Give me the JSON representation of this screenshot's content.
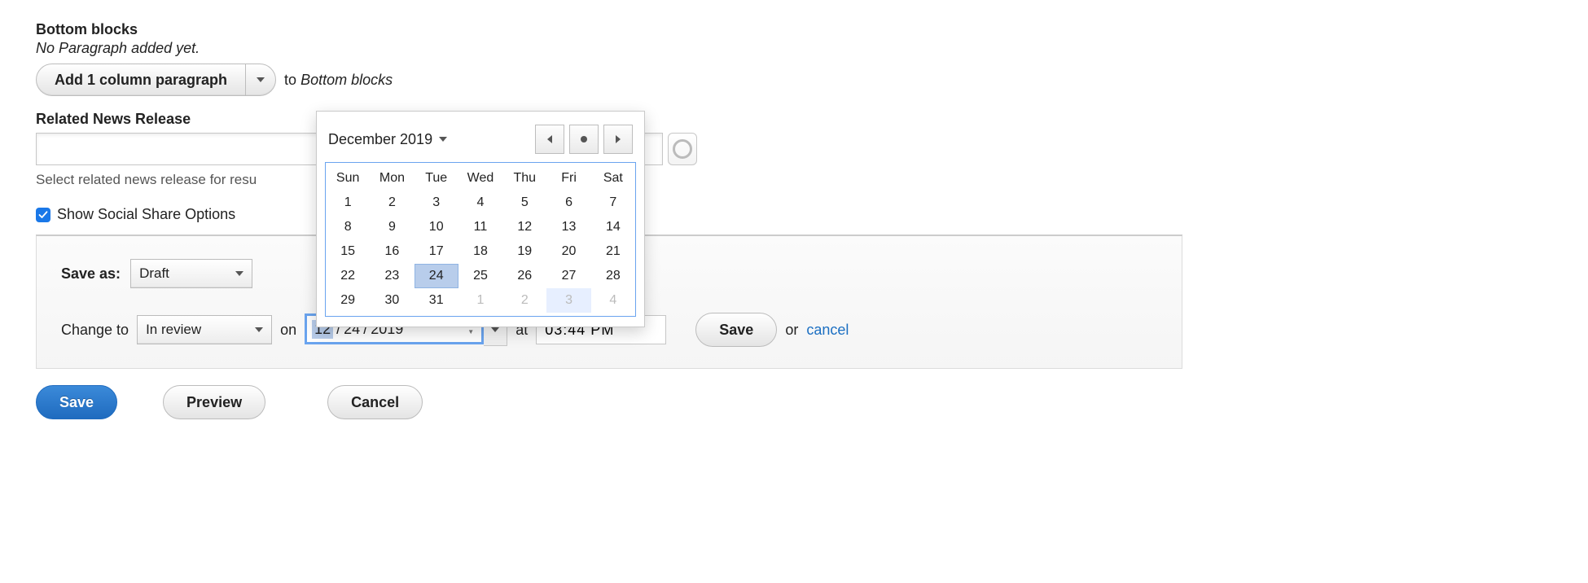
{
  "bottom_blocks": {
    "heading": "Bottom blocks",
    "empty_text": "No Paragraph added yet.",
    "add_button_label": "Add 1 column paragraph",
    "to_prefix": "to",
    "to_target": "Bottom blocks"
  },
  "related_release": {
    "heading": "Related News Release",
    "value": "",
    "help_text": "Select related news release for resu"
  },
  "social_share": {
    "checkbox_label": "Show Social Share Options",
    "checked": true
  },
  "schedule": {
    "save_as_label": "Save as:",
    "save_as_value": "Draft",
    "change_to_label": "Change to",
    "change_to_value": "In review",
    "on_label": "on",
    "date_mm": "12",
    "date_dd": "24",
    "date_yyyy": "2019",
    "at_label": "at",
    "time_value": "03:44 PM",
    "save_btn": "Save",
    "or_label": "or",
    "cancel_link": "cancel"
  },
  "buttons": {
    "save": "Save",
    "preview": "Preview",
    "cancel": "Cancel"
  },
  "datepicker": {
    "title": "December 2019",
    "selected_day": 24,
    "today_day": 3,
    "weekdays": [
      "Sun",
      "Mon",
      "Tue",
      "Wed",
      "Thu",
      "Fri",
      "Sat"
    ],
    "weeks": [
      [
        {
          "n": 1
        },
        {
          "n": 2
        },
        {
          "n": 3
        },
        {
          "n": 4
        },
        {
          "n": 5
        },
        {
          "n": 6
        },
        {
          "n": 7
        }
      ],
      [
        {
          "n": 8
        },
        {
          "n": 9
        },
        {
          "n": 10
        },
        {
          "n": 11
        },
        {
          "n": 12
        },
        {
          "n": 13
        },
        {
          "n": 14
        }
      ],
      [
        {
          "n": 15
        },
        {
          "n": 16
        },
        {
          "n": 17
        },
        {
          "n": 18
        },
        {
          "n": 19
        },
        {
          "n": 20
        },
        {
          "n": 21
        }
      ],
      [
        {
          "n": 22
        },
        {
          "n": 23
        },
        {
          "n": 24,
          "sel": true
        },
        {
          "n": 25
        },
        {
          "n": 26
        },
        {
          "n": 27
        },
        {
          "n": 28
        }
      ],
      [
        {
          "n": 29
        },
        {
          "n": 30
        },
        {
          "n": 31
        },
        {
          "n": 1,
          "out": true
        },
        {
          "n": 2,
          "out": true
        },
        {
          "n": 3,
          "out": true,
          "today": true
        },
        {
          "n": 4,
          "out": true
        }
      ]
    ]
  }
}
